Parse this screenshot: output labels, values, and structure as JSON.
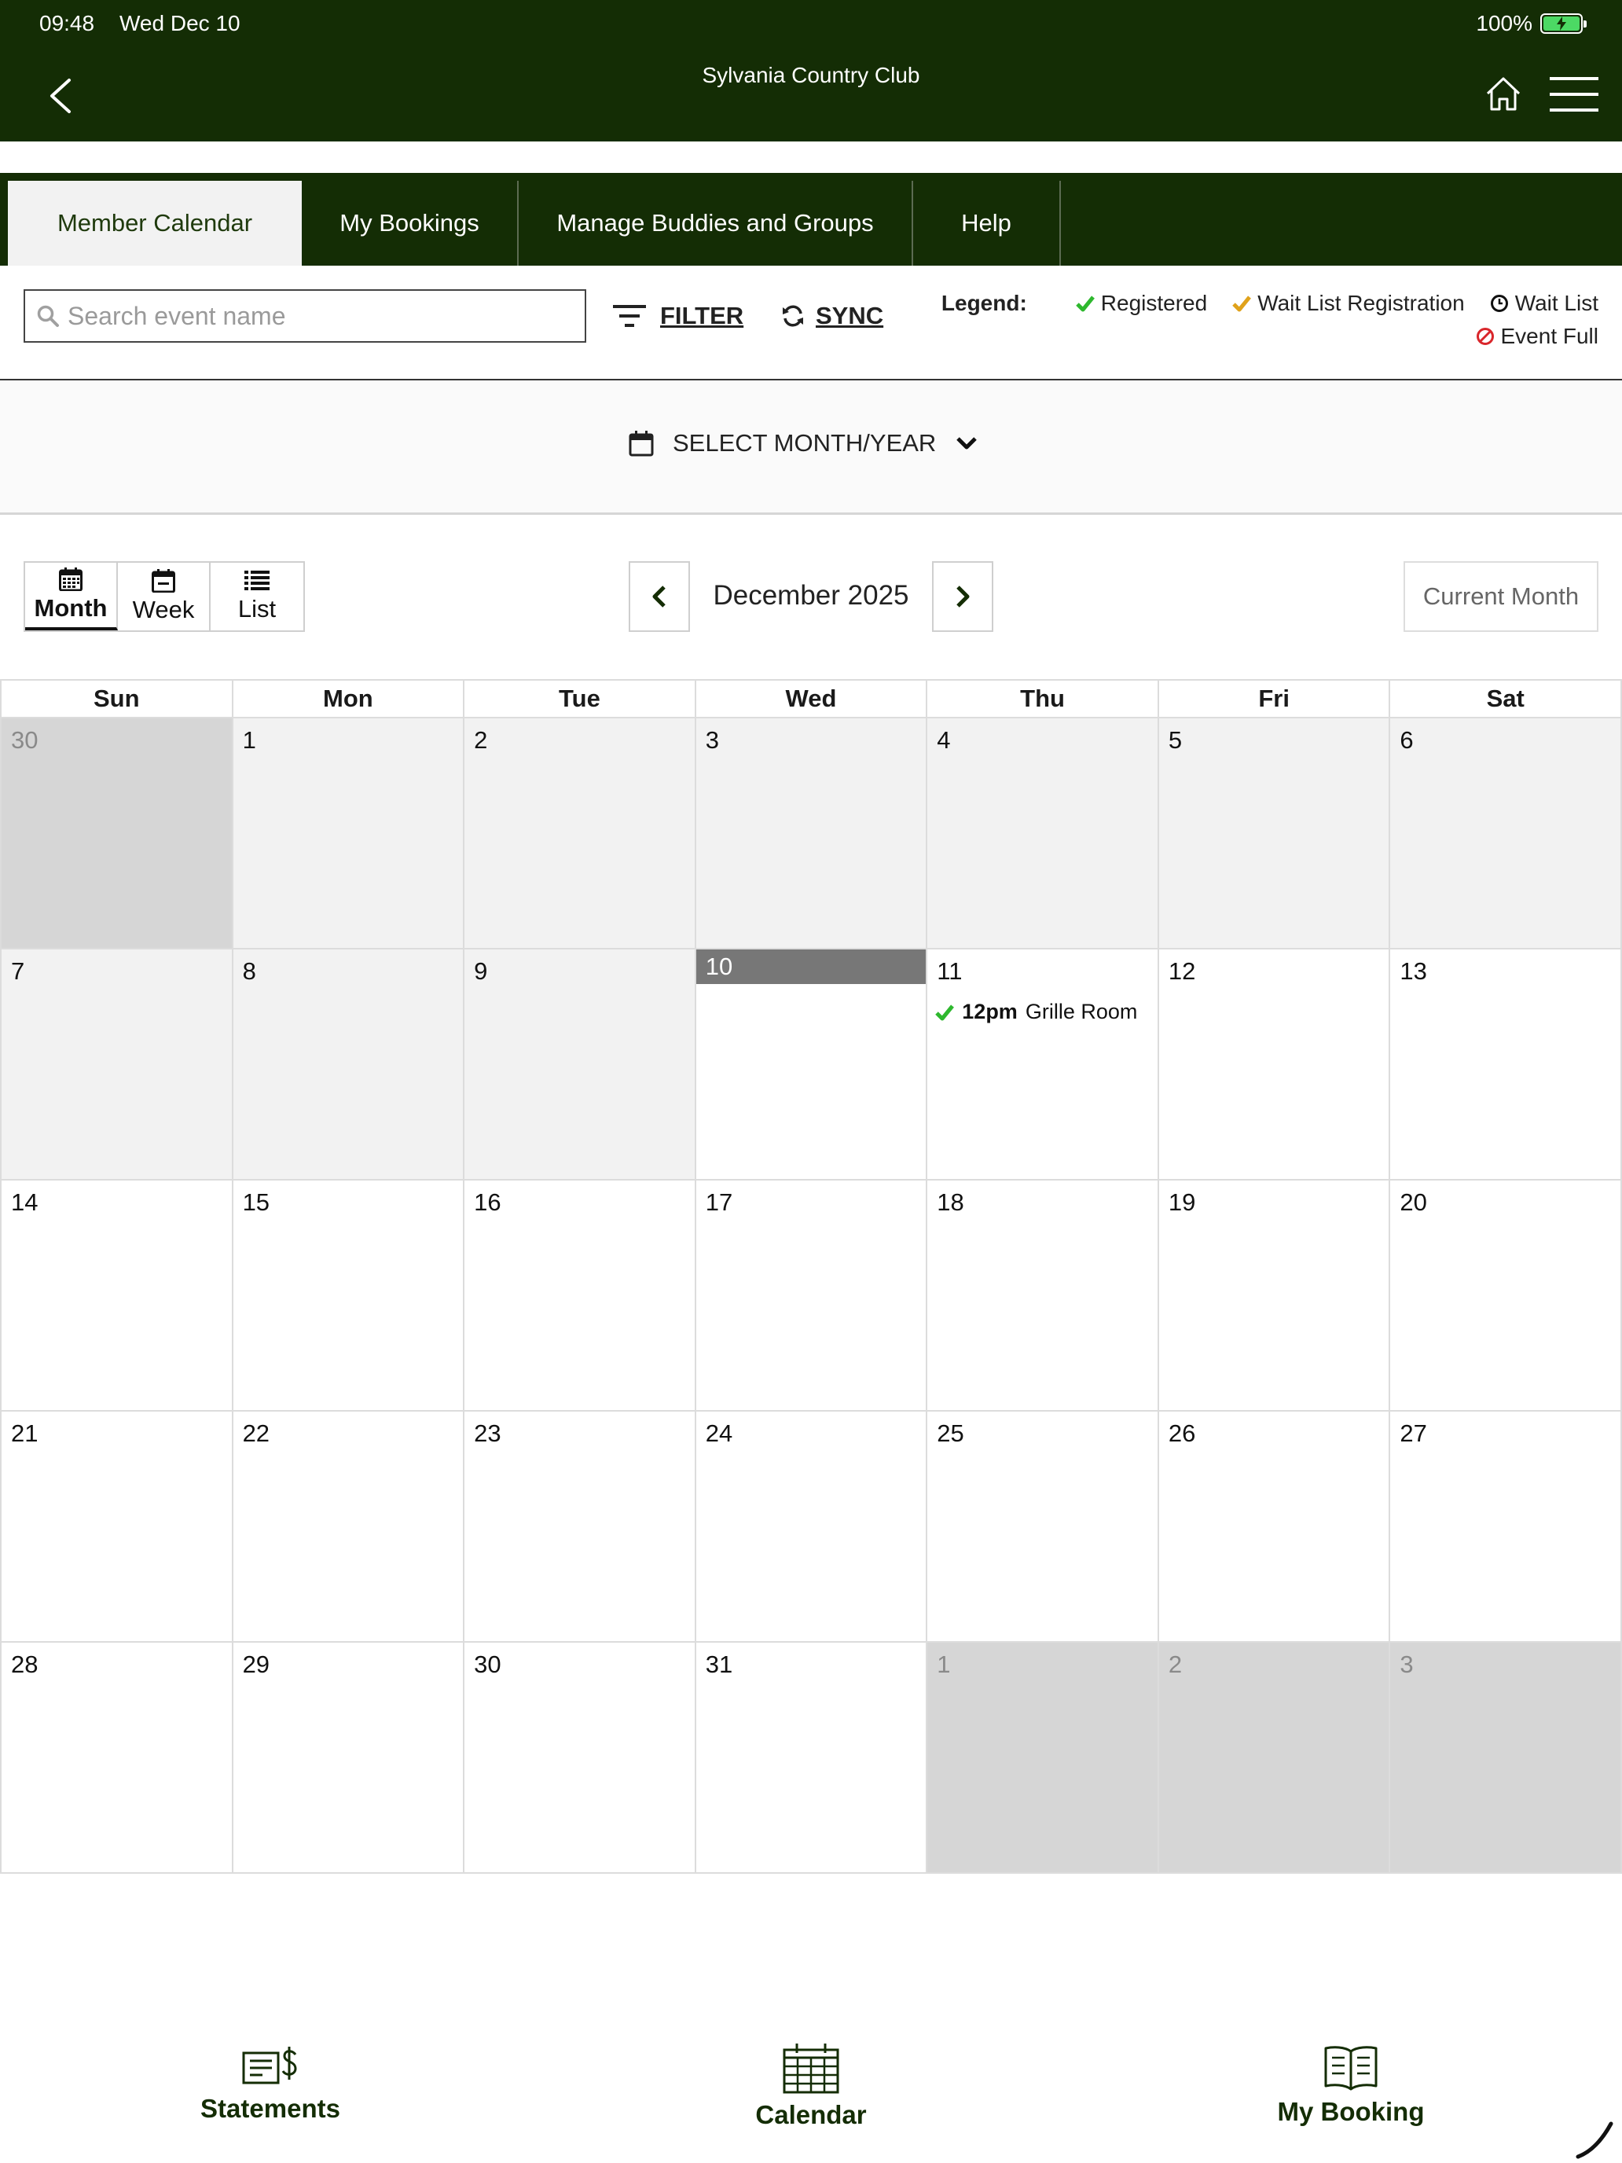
{
  "status_bar": {
    "time": "09:48",
    "date": "Wed Dec 10",
    "battery": "100%"
  },
  "app": {
    "title": "Sylvania Country Club"
  },
  "tabs": [
    {
      "label": "Member Calendar",
      "active": true
    },
    {
      "label": "My Bookings",
      "active": false
    },
    {
      "label": "Manage Buddies and Groups",
      "active": false
    },
    {
      "label": "Help",
      "active": false
    }
  ],
  "toolbar": {
    "search_placeholder": "Search event name",
    "filter_label": "FILTER",
    "sync_label": "SYNC"
  },
  "legend": {
    "title": "Legend:",
    "items": [
      {
        "label": "Registered",
        "icon": "check-icon",
        "color": "#2eb82e"
      },
      {
        "label": "Wait List Registration",
        "icon": "check-icon",
        "color": "#e0a21b"
      },
      {
        "label": "Wait List",
        "icon": "clock-icon",
        "color": "#111111"
      },
      {
        "label": "Event Full",
        "icon": "prohibited-icon",
        "color": "#d9262b"
      }
    ]
  },
  "month_select": {
    "label": "SELECT MONTH/YEAR"
  },
  "view": {
    "modes": [
      "Month",
      "Week",
      "List"
    ],
    "selected": "Month",
    "month_label": "December 2025",
    "current_month_label": "Current Month"
  },
  "calendar": {
    "weekdays": [
      "Sun",
      "Mon",
      "Tue",
      "Wed",
      "Thu",
      "Fri",
      "Sat"
    ],
    "weeks": [
      [
        {
          "day": "30",
          "state": "other"
        },
        {
          "day": "1",
          "state": "past"
        },
        {
          "day": "2",
          "state": "past"
        },
        {
          "day": "3",
          "state": "past"
        },
        {
          "day": "4",
          "state": "past"
        },
        {
          "day": "5",
          "state": "past"
        },
        {
          "day": "6",
          "state": "past"
        }
      ],
      [
        {
          "day": "7",
          "state": "past"
        },
        {
          "day": "8",
          "state": "past"
        },
        {
          "day": "9",
          "state": "past"
        },
        {
          "day": "10",
          "state": "today"
        },
        {
          "day": "11",
          "state": "future"
        },
        {
          "day": "12",
          "state": "future"
        },
        {
          "day": "13",
          "state": "future"
        }
      ],
      [
        {
          "day": "14",
          "state": "future"
        },
        {
          "day": "15",
          "state": "future"
        },
        {
          "day": "16",
          "state": "future"
        },
        {
          "day": "17",
          "state": "future"
        },
        {
          "day": "18",
          "state": "future"
        },
        {
          "day": "19",
          "state": "future"
        },
        {
          "day": "20",
          "state": "future"
        }
      ],
      [
        {
          "day": "21",
          "state": "future"
        },
        {
          "day": "22",
          "state": "future"
        },
        {
          "day": "23",
          "state": "future"
        },
        {
          "day": "24",
          "state": "future"
        },
        {
          "day": "25",
          "state": "future"
        },
        {
          "day": "26",
          "state": "future"
        },
        {
          "day": "27",
          "state": "future"
        }
      ],
      [
        {
          "day": "28",
          "state": "future"
        },
        {
          "day": "29",
          "state": "future"
        },
        {
          "day": "30",
          "state": "future"
        },
        {
          "day": "31",
          "state": "future"
        },
        {
          "day": "1",
          "state": "other"
        },
        {
          "day": "2",
          "state": "other"
        },
        {
          "day": "3",
          "state": "other"
        }
      ]
    ],
    "events": [
      {
        "week": 1,
        "weekday": 4,
        "time": "12pm",
        "name": "Grille Room",
        "status": "Registered"
      }
    ]
  },
  "bottom_nav": [
    {
      "label": "Statements",
      "icon": "statement-dollar-icon"
    },
    {
      "label": "Calendar",
      "icon": "calendar-grid-icon"
    },
    {
      "label": "My Booking",
      "icon": "open-book-icon"
    }
  ],
  "colors": {
    "brand_dark_green": "#142d05",
    "registered_green": "#2eb82e",
    "waitlist_orange": "#e0a21b",
    "event_full_red": "#d9262b",
    "today_gray": "#777777"
  }
}
